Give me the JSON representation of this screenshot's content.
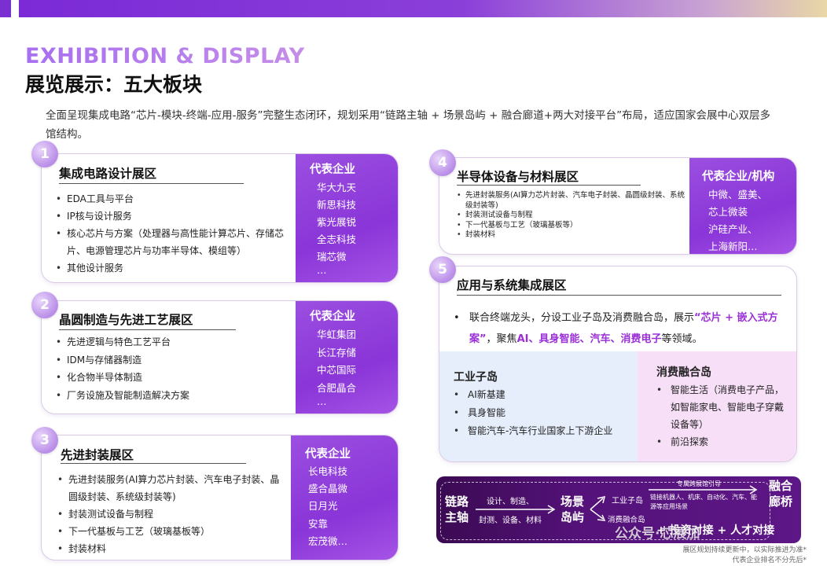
{
  "header": {
    "en_title": "EXHIBITION & DISPLAY",
    "cn_title": "展览展示：五大板块",
    "intro": "全面呈现集成电路“芯片-模块-终端-应用-服务”完整生态闭环，规划采用“链路主轴 + 场景岛屿 + 融合廊道+两大对接平台”布局，适应国家会展中心双层多馆结构。"
  },
  "zones": [
    {
      "number": "1",
      "title": "集成电路设计展区",
      "bullets": [
        "EDA工具与平台",
        "IP核与设计服务",
        "核心芯片与方案（处理器与高性能计算芯片、存储芯片、电源管理芯片与功率半导体、模组等）",
        "其他设计服务"
      ],
      "side_title": "代表企业",
      "companies": [
        "华大九天",
        "新思科技",
        "紫光展锐",
        "全志科技",
        "瑞芯微",
        "…"
      ]
    },
    {
      "number": "2",
      "title": "晶圆制造与先进工艺展区",
      "bullets": [
        "先进逻辑与特色工艺平台",
        "IDM与存储器制造",
        "化合物半导体制造",
        "厂务设施及智能制造解决方案"
      ],
      "side_title": "代表企业",
      "companies": [
        "华虹集团",
        "长江存储",
        "中芯国际",
        "合肥晶合",
        "…"
      ]
    },
    {
      "number": "3",
      "title": "先进封装展区",
      "bullets": [
        "先进封装服务(AI算力芯片封装、汽车电子封装、晶圆级封装、系统级封装等)",
        "封装测试设备与制程",
        "下一代基板与工艺（玻璃基板等）",
        "封装材料"
      ],
      "side_title": "代表企业",
      "companies": [
        "长电科技",
        "盛合晶微",
        "日月光",
        "安靠",
        "宏茂微…"
      ]
    },
    {
      "number": "4",
      "title": "半导体设备与材料展区",
      "bullets": [
        "先进封装服务(AI算力芯片封装、汽车电子封装、晶圆级封装、系统级封装等)",
        "封装测试设备与制程",
        "下一代基板与工艺（玻璃基板等）",
        "封装材料"
      ],
      "side_title": "代表企业/机构",
      "companies": [
        "中微、盛美、",
        "芯上微装",
        "沪硅产业、",
        "上海新阳…"
      ]
    },
    {
      "number": "5",
      "title": "应用与系统集成展区",
      "desc_pre": "联合终端龙头，分设工业子岛及消费融合岛，展示",
      "desc_hl1": "“芯片 + 嵌入式方案”",
      "desc_mid": "，聚焦",
      "desc_hl2": "AI、具身智能、汽车、消费电子",
      "desc_post": "等领域。",
      "sub_left": {
        "title": "工业子岛",
        "items": [
          "AI新基建",
          "具身智能",
          "智能汽车-汽车行业国家上下游企业"
        ]
      },
      "sub_right": {
        "title": "消费融合岛",
        "items": [
          "智能生活（消费电子产品，如智能家电、智能电子穿戴设备等）",
          "前沿探索"
        ]
      }
    }
  ],
  "diagram": {
    "axis": "链路主轴",
    "mid_top": "设计、制造、",
    "mid_bottom": "封测、设备、材料",
    "island": "场景岛屿",
    "branch_top": "工业子岛",
    "branch_bottom": "消费融合岛",
    "guide": "专属跨展馆引导",
    "corridor_text": "链接机器人、机床、自动化、汽车、能源等应用场景",
    "corridor": "融合廊桥",
    "platforms": "+ 投资对接 + 人才对接"
  },
  "footnote": [
    "展区规划持续更新中，以实际推进为准*",
    "代表企业排名不分先后*"
  ],
  "watermark": "公众号·芯展加",
  "colors": {
    "accent": "#8a35d8",
    "highlight": "#9b2fd6",
    "dark_panel": "#4a0f6b"
  }
}
